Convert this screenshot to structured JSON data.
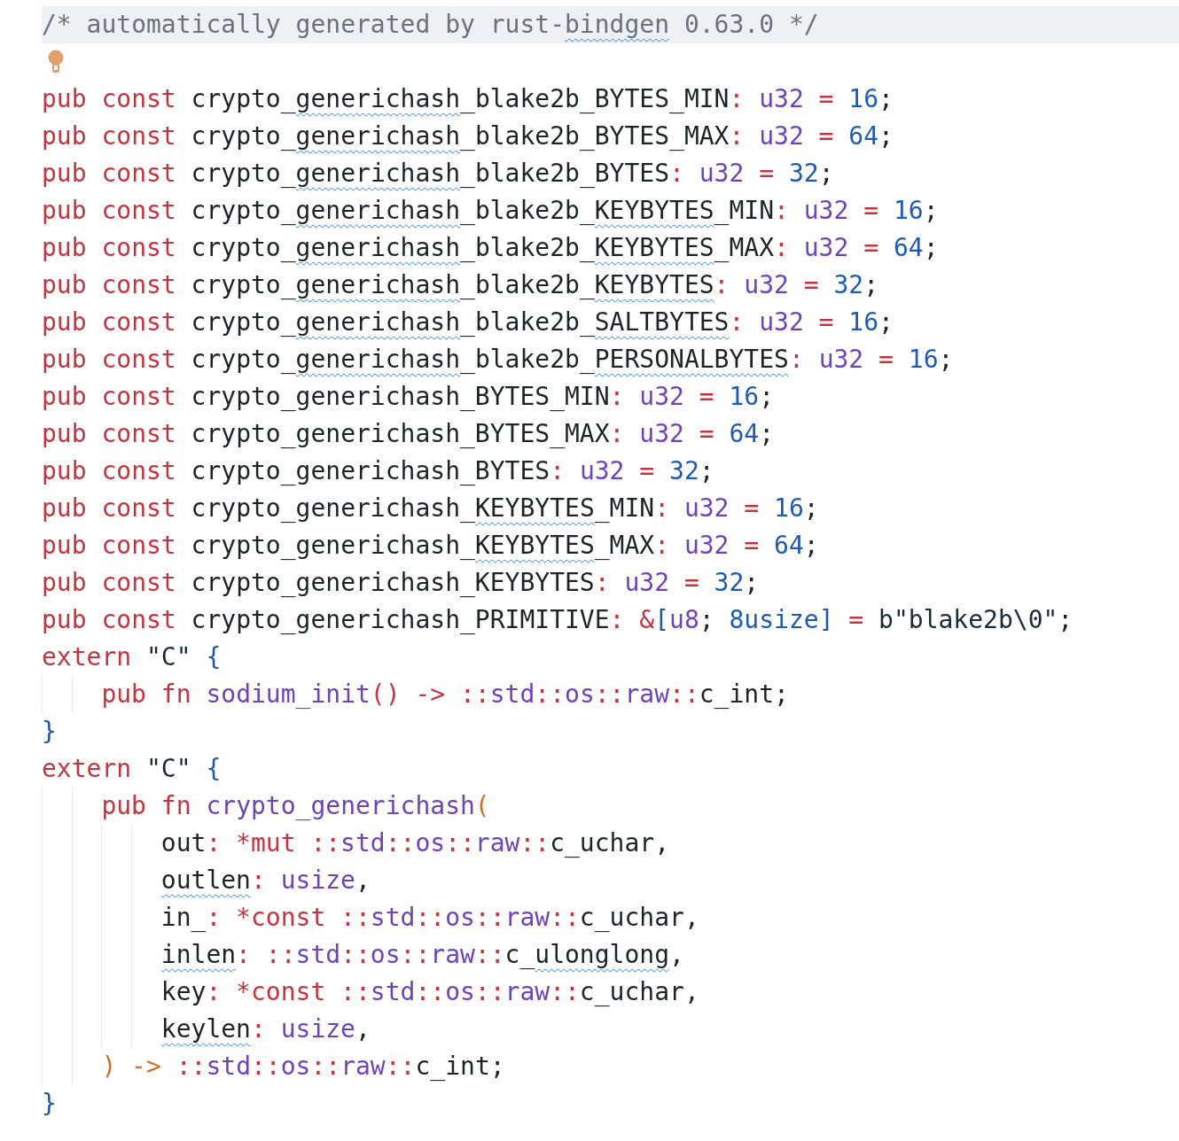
{
  "editor": {
    "lines": [
      {
        "current": true,
        "segments": [
          {
            "text": "/* automatically generated by rust-",
            "kind": "comment"
          },
          {
            "text": "bindgen",
            "kind": "flagged_comment"
          },
          {
            "text": " 0.63.0 */",
            "kind": "comment"
          }
        ]
      },
      {
        "current": false,
        "lightbulb": true
      },
      {
        "current": false,
        "segments": [
          {
            "text": "pub const ",
            "kind": "keyword"
          },
          {
            "text": "crypto_",
            "kind": "ident"
          },
          {
            "text": "generichash",
            "kind": "flagged"
          },
          {
            "text": "_blake2b_BYTES_MIN",
            "kind": "ident"
          },
          {
            "text": ": ",
            "kind": "punct"
          },
          {
            "text": "u32",
            "kind": "type"
          },
          {
            "text": " = ",
            "kind": "punct"
          },
          {
            "text": "16",
            "kind": "number"
          },
          {
            "text": ";",
            "kind": "plain"
          }
        ]
      },
      {
        "current": false,
        "segments": [
          {
            "text": "pub const ",
            "kind": "keyword"
          },
          {
            "text": "crypto_",
            "kind": "ident"
          },
          {
            "text": "generichash",
            "kind": "flagged"
          },
          {
            "text": "_blake2b_BYTES_MAX",
            "kind": "ident"
          },
          {
            "text": ": ",
            "kind": "punct"
          },
          {
            "text": "u32",
            "kind": "type"
          },
          {
            "text": " = ",
            "kind": "punct"
          },
          {
            "text": "64",
            "kind": "number"
          },
          {
            "text": ";",
            "kind": "plain"
          }
        ]
      },
      {
        "current": false,
        "segments": [
          {
            "text": "pub const ",
            "kind": "keyword"
          },
          {
            "text": "crypto_",
            "kind": "ident"
          },
          {
            "text": "generichash",
            "kind": "flagged"
          },
          {
            "text": "_blake2b_BYTES",
            "kind": "ident"
          },
          {
            "text": ": ",
            "kind": "punct"
          },
          {
            "text": "u32",
            "kind": "type"
          },
          {
            "text": " = ",
            "kind": "punct"
          },
          {
            "text": "32",
            "kind": "number"
          },
          {
            "text": ";",
            "kind": "plain"
          }
        ]
      },
      {
        "current": false,
        "segments": [
          {
            "text": "pub const ",
            "kind": "keyword"
          },
          {
            "text": "crypto_",
            "kind": "ident"
          },
          {
            "text": "generichash",
            "kind": "flagged"
          },
          {
            "text": "_blake2b_",
            "kind": "ident"
          },
          {
            "text": "KEYBYTES",
            "kind": "flagged"
          },
          {
            "text": "_MIN",
            "kind": "ident"
          },
          {
            "text": ": ",
            "kind": "punct"
          },
          {
            "text": "u32",
            "kind": "type"
          },
          {
            "text": " = ",
            "kind": "punct"
          },
          {
            "text": "16",
            "kind": "number"
          },
          {
            "text": ";",
            "kind": "plain"
          }
        ]
      },
      {
        "current": false,
        "segments": [
          {
            "text": "pub const ",
            "kind": "keyword"
          },
          {
            "text": "crypto_",
            "kind": "ident"
          },
          {
            "text": "generichash",
            "kind": "flagged"
          },
          {
            "text": "_blake2b_",
            "kind": "ident"
          },
          {
            "text": "KEYBYTES",
            "kind": "flagged"
          },
          {
            "text": "_MAX",
            "kind": "ident"
          },
          {
            "text": ": ",
            "kind": "punct"
          },
          {
            "text": "u32",
            "kind": "type"
          },
          {
            "text": " = ",
            "kind": "punct"
          },
          {
            "text": "64",
            "kind": "number"
          },
          {
            "text": ";",
            "kind": "plain"
          }
        ]
      },
      {
        "current": false,
        "segments": [
          {
            "text": "pub const ",
            "kind": "keyword"
          },
          {
            "text": "crypto_",
            "kind": "ident"
          },
          {
            "text": "generichash",
            "kind": "flagged"
          },
          {
            "text": "_blake2b_",
            "kind": "ident"
          },
          {
            "text": "KEYBYTES",
            "kind": "flagged"
          },
          {
            "text": ": ",
            "kind": "punct"
          },
          {
            "text": "u32",
            "kind": "type"
          },
          {
            "text": " = ",
            "kind": "punct"
          },
          {
            "text": "32",
            "kind": "number"
          },
          {
            "text": ";",
            "kind": "plain"
          }
        ]
      },
      {
        "current": false,
        "segments": [
          {
            "text": "pub const ",
            "kind": "keyword"
          },
          {
            "text": "crypto_",
            "kind": "ident"
          },
          {
            "text": "generichash",
            "kind": "flagged"
          },
          {
            "text": "_blake2b_",
            "kind": "ident"
          },
          {
            "text": "SALTBYTES",
            "kind": "flagged"
          },
          {
            "text": ": ",
            "kind": "punct"
          },
          {
            "text": "u32",
            "kind": "type"
          },
          {
            "text": " = ",
            "kind": "punct"
          },
          {
            "text": "16",
            "kind": "number"
          },
          {
            "text": ";",
            "kind": "plain"
          }
        ]
      },
      {
        "current": false,
        "segments": [
          {
            "text": "pub const ",
            "kind": "keyword"
          },
          {
            "text": "crypto_",
            "kind": "ident"
          },
          {
            "text": "generichash",
            "kind": "flagged"
          },
          {
            "text": "_blake2b_",
            "kind": "ident"
          },
          {
            "text": "PERSONALBYTES",
            "kind": "flagged"
          },
          {
            "text": ": ",
            "kind": "punct"
          },
          {
            "text": "u32",
            "kind": "type"
          },
          {
            "text": " = ",
            "kind": "punct"
          },
          {
            "text": "16",
            "kind": "number"
          },
          {
            "text": ";",
            "kind": "plain"
          }
        ]
      },
      {
        "current": false,
        "segments": [
          {
            "text": "pub const ",
            "kind": "keyword"
          },
          {
            "text": "crypto_generichash_BYTES_MIN",
            "kind": "ident"
          },
          {
            "text": ": ",
            "kind": "punct"
          },
          {
            "text": "u32",
            "kind": "type"
          },
          {
            "text": " = ",
            "kind": "punct"
          },
          {
            "text": "16",
            "kind": "number"
          },
          {
            "text": ";",
            "kind": "plain"
          }
        ]
      },
      {
        "current": false,
        "segments": [
          {
            "text": "pub const ",
            "kind": "keyword"
          },
          {
            "text": "crypto_generichash_BYTES_MAX",
            "kind": "ident"
          },
          {
            "text": ": ",
            "kind": "punct"
          },
          {
            "text": "u32",
            "kind": "type"
          },
          {
            "text": " = ",
            "kind": "punct"
          },
          {
            "text": "64",
            "kind": "number"
          },
          {
            "text": ";",
            "kind": "plain"
          }
        ]
      },
      {
        "current": false,
        "segments": [
          {
            "text": "pub const ",
            "kind": "keyword"
          },
          {
            "text": "crypto_generichash_BYTES",
            "kind": "ident"
          },
          {
            "text": ": ",
            "kind": "punct"
          },
          {
            "text": "u32",
            "kind": "type"
          },
          {
            "text": " = ",
            "kind": "punct"
          },
          {
            "text": "32",
            "kind": "number"
          },
          {
            "text": ";",
            "kind": "plain"
          }
        ]
      },
      {
        "current": false,
        "segments": [
          {
            "text": "pub const ",
            "kind": "keyword"
          },
          {
            "text": "crypto_generichash_",
            "kind": "ident"
          },
          {
            "text": "KEYBYTES",
            "kind": "flagged"
          },
          {
            "text": "_MIN",
            "kind": "ident"
          },
          {
            "text": ": ",
            "kind": "punct"
          },
          {
            "text": "u32",
            "kind": "type"
          },
          {
            "text": " = ",
            "kind": "punct"
          },
          {
            "text": "16",
            "kind": "number"
          },
          {
            "text": ";",
            "kind": "plain"
          }
        ]
      },
      {
        "current": false,
        "segments": [
          {
            "text": "pub const ",
            "kind": "keyword"
          },
          {
            "text": "crypto_generichash_",
            "kind": "ident"
          },
          {
            "text": "KEYBYTES",
            "kind": "flagged"
          },
          {
            "text": "_MAX",
            "kind": "ident"
          },
          {
            "text": ": ",
            "kind": "punct"
          },
          {
            "text": "u32",
            "kind": "type"
          },
          {
            "text": " = ",
            "kind": "punct"
          },
          {
            "text": "64",
            "kind": "number"
          },
          {
            "text": ";",
            "kind": "plain"
          }
        ]
      },
      {
        "current": false,
        "segments": [
          {
            "text": "pub const ",
            "kind": "keyword"
          },
          {
            "text": "crypto_generichash_KEYBYTES",
            "kind": "ident"
          },
          {
            "text": ": ",
            "kind": "punct"
          },
          {
            "text": "u32",
            "kind": "type"
          },
          {
            "text": " = ",
            "kind": "punct"
          },
          {
            "text": "32",
            "kind": "number"
          },
          {
            "text": ";",
            "kind": "plain"
          }
        ]
      },
      {
        "current": false,
        "segments": [
          {
            "text": "pub const ",
            "kind": "keyword"
          },
          {
            "text": "crypto_generichash_PRIMITIVE",
            "kind": "ident"
          },
          {
            "text": ": ",
            "kind": "punct"
          },
          {
            "text": "&",
            "kind": "punct"
          },
          {
            "text": "[",
            "kind": "brace"
          },
          {
            "text": "u8",
            "kind": "type"
          },
          {
            "text": "; ",
            "kind": "plain"
          },
          {
            "text": "8usize",
            "kind": "number"
          },
          {
            "text": "]",
            "kind": "brace"
          },
          {
            "text": " = ",
            "kind": "punct"
          },
          {
            "text": "b\"blake2b\\0\"",
            "kind": "string"
          },
          {
            "text": ";",
            "kind": "plain"
          }
        ]
      },
      {
        "current": false,
        "segments": [
          {
            "text": "extern ",
            "kind": "keyword"
          },
          {
            "text": "\"C\"",
            "kind": "string"
          },
          {
            "text": " {",
            "kind": "brace"
          }
        ],
        "children": [
          {
            "current": false,
            "segments": [
              {
                "text": "pub fn ",
                "kind": "keyword"
              },
              {
                "text": "sodium_init",
                "kind": "function"
              },
              {
                "text": "()",
                "kind": "punct"
              },
              {
                "text": " -> ::",
                "kind": "punct"
              },
              {
                "text": "std",
                "kind": "type"
              },
              {
                "text": "::",
                "kind": "punct"
              },
              {
                "text": "os",
                "kind": "type"
              },
              {
                "text": "::",
                "kind": "punct"
              },
              {
                "text": "raw",
                "kind": "type"
              },
              {
                "text": "::",
                "kind": "punct"
              },
              {
                "text": "c_int",
                "kind": "ident"
              },
              {
                "text": ";",
                "kind": "plain"
              }
            ]
          }
        ]
      },
      {
        "current": false,
        "segments": [
          {
            "text": "}",
            "kind": "brace"
          }
        ]
      },
      {
        "current": false,
        "segments": [
          {
            "text": "extern ",
            "kind": "keyword"
          },
          {
            "text": "\"C\"",
            "kind": "string"
          },
          {
            "text": " {",
            "kind": "brace"
          }
        ],
        "children": [
          {
            "current": false,
            "segments": [
              {
                "text": "pub fn ",
                "kind": "keyword"
              },
              {
                "text": "crypto_generichash",
                "kind": "function"
              },
              {
                "text": "(",
                "kind": "paren"
              }
            ],
            "children": [
              {
                "current": false,
                "segments": [
                  {
                    "text": "out",
                    "kind": "ident"
                  },
                  {
                    "text": ": *mut ::",
                    "kind": "punct"
                  },
                  {
                    "text": "std",
                    "kind": "type"
                  },
                  {
                    "text": "::",
                    "kind": "punct"
                  },
                  {
                    "text": "os",
                    "kind": "type"
                  },
                  {
                    "text": "::",
                    "kind": "punct"
                  },
                  {
                    "text": "raw",
                    "kind": "type"
                  },
                  {
                    "text": "::",
                    "kind": "punct"
                  },
                  {
                    "text": "c_uchar",
                    "kind": "ident"
                  },
                  {
                    "text": ",",
                    "kind": "plain"
                  }
                ]
              },
              {
                "current": false,
                "segments": [
                  {
                    "text": "outlen",
                    "kind": "flagged"
                  },
                  {
                    "text": ": ",
                    "kind": "punct"
                  },
                  {
                    "text": "usize",
                    "kind": "type"
                  },
                  {
                    "text": ",",
                    "kind": "plain"
                  }
                ]
              },
              {
                "current": false,
                "segments": [
                  {
                    "text": "in_",
                    "kind": "ident"
                  },
                  {
                    "text": ": *const ::",
                    "kind": "punct"
                  },
                  {
                    "text": "std",
                    "kind": "type"
                  },
                  {
                    "text": "::",
                    "kind": "punct"
                  },
                  {
                    "text": "os",
                    "kind": "type"
                  },
                  {
                    "text": "::",
                    "kind": "punct"
                  },
                  {
                    "text": "raw",
                    "kind": "type"
                  },
                  {
                    "text": "::",
                    "kind": "punct"
                  },
                  {
                    "text": "c_uchar",
                    "kind": "ident"
                  },
                  {
                    "text": ",",
                    "kind": "plain"
                  }
                ]
              },
              {
                "current": false,
                "segments": [
                  {
                    "text": "inlen",
                    "kind": "flagged"
                  },
                  {
                    "text": ": ::",
                    "kind": "punct"
                  },
                  {
                    "text": "std",
                    "kind": "type"
                  },
                  {
                    "text": "::",
                    "kind": "punct"
                  },
                  {
                    "text": "os",
                    "kind": "type"
                  },
                  {
                    "text": "::",
                    "kind": "punct"
                  },
                  {
                    "text": "raw",
                    "kind": "type"
                  },
                  {
                    "text": "::",
                    "kind": "punct"
                  },
                  {
                    "text": "c_",
                    "kind": "ident"
                  },
                  {
                    "text": "ulonglong",
                    "kind": "flagged"
                  },
                  {
                    "text": ",",
                    "kind": "plain"
                  }
                ]
              },
              {
                "current": false,
                "segments": [
                  {
                    "text": "key",
                    "kind": "ident"
                  },
                  {
                    "text": ": *const ::",
                    "kind": "punct"
                  },
                  {
                    "text": "std",
                    "kind": "type"
                  },
                  {
                    "text": "::",
                    "kind": "punct"
                  },
                  {
                    "text": "os",
                    "kind": "type"
                  },
                  {
                    "text": "::",
                    "kind": "punct"
                  },
                  {
                    "text": "raw",
                    "kind": "type"
                  },
                  {
                    "text": "::",
                    "kind": "punct"
                  },
                  {
                    "text": "c_uchar",
                    "kind": "ident"
                  },
                  {
                    "text": ",",
                    "kind": "plain"
                  }
                ]
              },
              {
                "current": false,
                "segments": [
                  {
                    "text": "keylen",
                    "kind": "flagged"
                  },
                  {
                    "text": ": ",
                    "kind": "punct"
                  },
                  {
                    "text": "usize",
                    "kind": "type"
                  },
                  {
                    "text": ",",
                    "kind": "plain"
                  }
                ]
              }
            ]
          },
          {
            "current": false,
            "segments": [
              {
                "text": ")",
                "kind": "paren"
              },
              {
                "text": " -> ",
                "kind": "paren"
              },
              {
                "text": "::",
                "kind": "punct"
              },
              {
                "text": "std",
                "kind": "type"
              },
              {
                "text": "::",
                "kind": "punct"
              },
              {
                "text": "os",
                "kind": "type"
              },
              {
                "text": "::",
                "kind": "punct"
              },
              {
                "text": "raw",
                "kind": "type"
              },
              {
                "text": "::",
                "kind": "punct"
              },
              {
                "text": "c_int",
                "kind": "ident"
              },
              {
                "text": ";",
                "kind": "plain"
              }
            ]
          }
        ]
      },
      {
        "current": false,
        "segments": [
          {
            "text": "}",
            "kind": "brace"
          }
        ]
      }
    ]
  }
}
